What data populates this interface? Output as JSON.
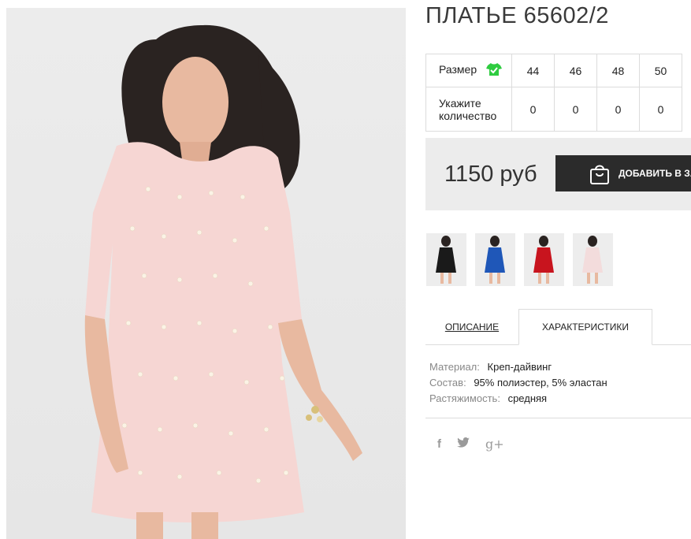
{
  "product": {
    "title": "ПЛАТЬЕ 65602/2",
    "price": "1150 руб",
    "add_to_cart_label": "ДОБАВИТЬ В ЗАКАЗ"
  },
  "size_table": {
    "size_label": "Размер",
    "qty_label_line1": "Укажите",
    "qty_label_line2": "количество",
    "sizes": [
      "44",
      "46",
      "48",
      "50"
    ],
    "quantities": [
      "0",
      "0",
      "0",
      "0"
    ]
  },
  "thumbnails": [
    {
      "color_name": "black",
      "dress_color": "#1a1a1a"
    },
    {
      "color_name": "blue",
      "dress_color": "#1f57b8"
    },
    {
      "color_name": "red",
      "dress_color": "#c8141e"
    },
    {
      "color_name": "pink",
      "dress_color": "#f3dcdc"
    }
  ],
  "tabs": {
    "description": "ОПИСАНИЕ",
    "characteristics": "ХАРАКТЕРИСТИКИ"
  },
  "specs": [
    {
      "key": "Материал:",
      "value": "Креп-дайвинг"
    },
    {
      "key": "Состав:",
      "value": "95% полиэстер, 5% эластан"
    },
    {
      "key": "Растяжимость:",
      "value": "средняя"
    }
  ],
  "social": {
    "facebook": "f",
    "twitter": "twitter-icon",
    "googleplus": "g+"
  },
  "colors": {
    "dress_main": "#f6d6d3",
    "button_bg": "#2b2b2b",
    "price_box_bg": "#ececec",
    "check_green": "#2ecc40"
  }
}
